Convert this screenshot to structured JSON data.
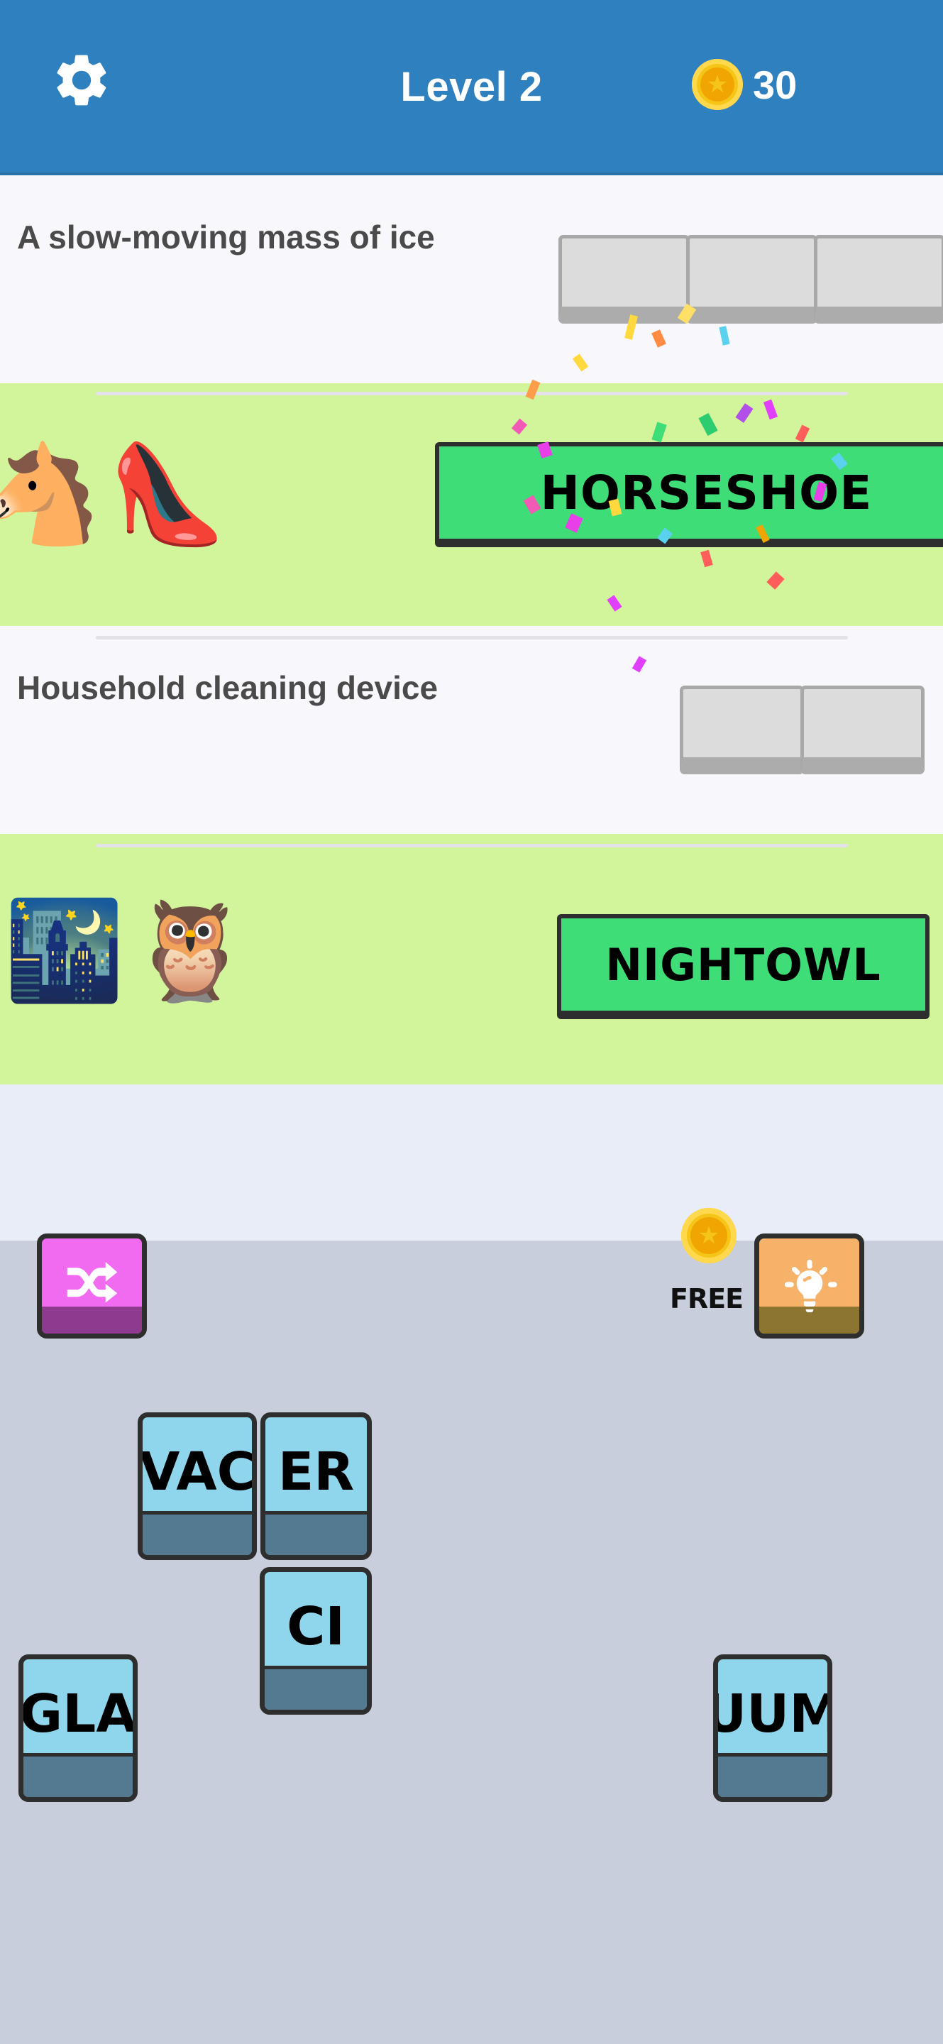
{
  "header": {
    "settings_icon": "gear-icon",
    "title": "Level 2",
    "coin_icon": "coin-icon",
    "coin_count": "30",
    "bg_color": "#2E80BE"
  },
  "puzzle_rows": [
    {
      "kind": "clue",
      "clue": "A slow-moving mass of ice",
      "solved": false,
      "slot_count": 3,
      "answer": ""
    },
    {
      "kind": "emoji",
      "emojis": [
        "horse-face-emoji",
        "high-heeled-shoe-emoji"
      ],
      "emoji_glyphs": [
        "🐴",
        "👠"
      ],
      "solved": true,
      "answer": "HORSESHOE",
      "slot_count": 0
    },
    {
      "kind": "clue",
      "clue": "Household cleaning device",
      "solved": false,
      "slot_count": 2,
      "answer": ""
    },
    {
      "kind": "emoji",
      "emojis": [
        "night-with-stars-emoji",
        "owl-emoji"
      ],
      "emoji_glyphs": [
        "🌃",
        "🦉"
      ],
      "solved": true,
      "answer": "NIGHTOWL",
      "slot_count": 0
    }
  ],
  "toolbar": {
    "shuffle_icon": "shuffle-icon",
    "shuffle_color": "#F06BF0",
    "hint_icon": "lightbulb-icon",
    "hint_color": "#F7B26A",
    "hint_cost_label": "FREE",
    "hint_coin_icon": "coin-icon"
  },
  "letter_tiles": [
    {
      "text": "VAC"
    },
    {
      "text": "ER"
    },
    {
      "text": "CI"
    },
    {
      "text": "GLA"
    },
    {
      "text": "UUM"
    }
  ],
  "colors": {
    "header_blue": "#2E80BE",
    "row_white": "#F8F8FC",
    "row_green": "#D2F49B",
    "answer_green": "#3FDD77",
    "tile_blue": "#8FD6EC",
    "tile_lip": "#547A92",
    "panel_lavender": "#E8EDF7",
    "panel_gray": "#C9CEDC",
    "coin_gold": "#F5C518"
  }
}
